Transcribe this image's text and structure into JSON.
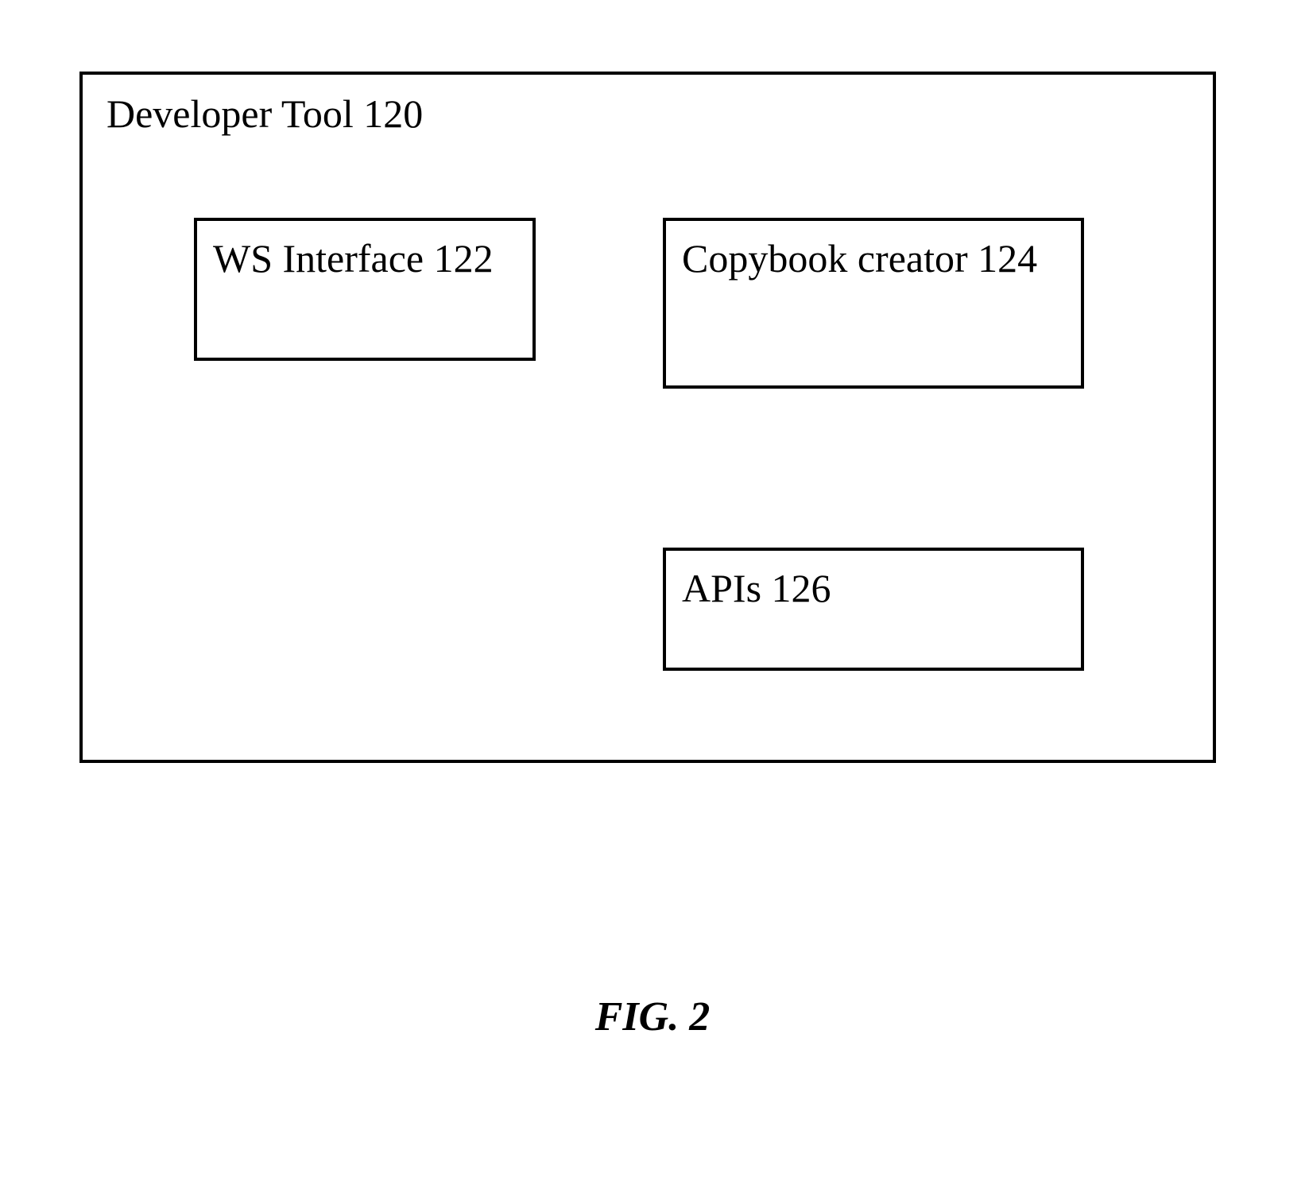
{
  "diagram": {
    "container_title": "Developer Tool 120",
    "boxes": {
      "ws_interface": "WS Interface 122",
      "copybook_creator": "Copybook creator 124",
      "apis": "APIs 126"
    },
    "caption": "FIG. 2"
  }
}
